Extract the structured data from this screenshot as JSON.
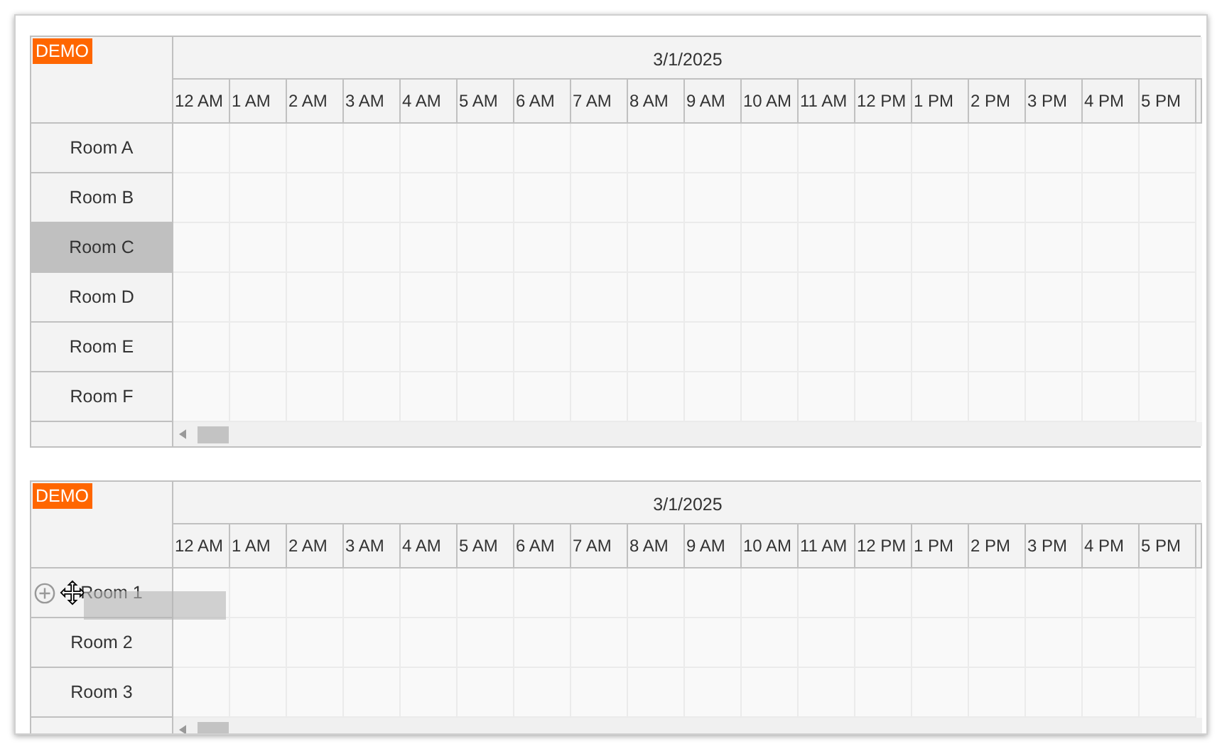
{
  "schedulers": [
    {
      "badge": "DEMO",
      "date": "3/1/2025",
      "hours": [
        "12 AM",
        "1 AM",
        "2 AM",
        "3 AM",
        "4 AM",
        "5 AM",
        "6 AM",
        "7 AM",
        "8 AM",
        "9 AM",
        "10 AM",
        "11 AM",
        "12 PM",
        "1 PM",
        "2 PM",
        "3 PM",
        "4 PM",
        "5 PM"
      ],
      "resources": [
        {
          "name": "Room A",
          "selected": false,
          "dragging": false
        },
        {
          "name": "Room B",
          "selected": false,
          "dragging": false
        },
        {
          "name": "Room C",
          "selected": true,
          "dragging": false
        },
        {
          "name": "Room D",
          "selected": false,
          "dragging": false
        },
        {
          "name": "Room E",
          "selected": false,
          "dragging": false
        },
        {
          "name": "Room F",
          "selected": false,
          "dragging": false
        }
      ]
    },
    {
      "badge": "DEMO",
      "date": "3/1/2025",
      "hours": [
        "12 AM",
        "1 AM",
        "2 AM",
        "3 AM",
        "4 AM",
        "5 AM",
        "6 AM",
        "7 AM",
        "8 AM",
        "9 AM",
        "10 AM",
        "11 AM",
        "12 PM",
        "1 PM",
        "2 PM",
        "3 PM",
        "4 PM",
        "5 PM"
      ],
      "resources": [
        {
          "name": "Room 1",
          "selected": false,
          "dragging": true
        },
        {
          "name": "Room 2",
          "selected": false,
          "dragging": false
        },
        {
          "name": "Room 3",
          "selected": false,
          "dragging": false
        }
      ]
    }
  ]
}
